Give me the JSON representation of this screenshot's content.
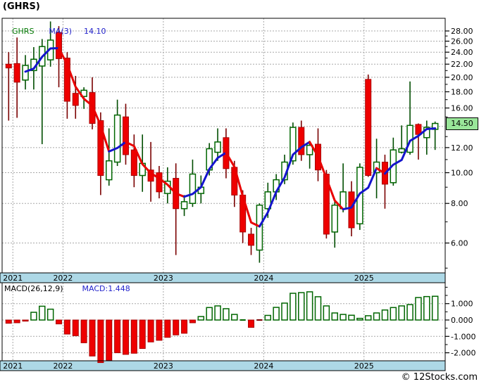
{
  "window": {
    "title": "(GHRS)"
  },
  "watermark": "© 12Stocks.com",
  "main_panel": {
    "legend": {
      "symbol": "GHRS",
      "ma_label": "MA(3)",
      "ma_value": "14.10"
    },
    "last_price_label": "14.50",
    "y_axis_labels": [
      "28.00",
      "26.00",
      "24.00",
      "22.00",
      "20.00",
      "18.00",
      "16.00",
      "12.00",
      "10.00",
      "8.00",
      "6.00"
    ]
  },
  "macd_panel": {
    "label": "MACD(26,12,9)",
    "value_label": "MACD:1.448",
    "y_axis_labels": [
      "1.000",
      "0.000",
      "-1.000",
      "-2.000"
    ]
  },
  "x_axis_years": [
    "2021",
    "2022",
    "2023",
    "2024",
    "2025"
  ],
  "colors": {
    "up_candle_border": "#006600",
    "up_candle_fill": "#FFFFFF",
    "down_candle_fill": "#EE0000",
    "down_candle_border": "#AA0000",
    "up_wick": "#004D00",
    "down_wick": "#7A0000",
    "ma_up": "#1414CC",
    "ma_down": "#E80000",
    "grid": "#A8A8A8",
    "axis_band_bg": "#ADD8E6",
    "price_badge_bg": "#99E699",
    "legend_symbol": "#007700",
    "legend_value": "#2222CC",
    "text": "#000000"
  },
  "chart_data": [
    {
      "type": "candlestick",
      "title": "GHRS monthly price with MA(3) overlay",
      "x_unit": "month",
      "months": [
        "2021-06",
        "2021-07",
        "2021-08",
        "2021-09",
        "2021-10",
        "2021-11",
        "2021-12",
        "2022-01",
        "2022-02",
        "2022-03",
        "2022-04",
        "2022-05",
        "2022-06",
        "2022-07",
        "2022-08",
        "2022-09",
        "2022-10",
        "2022-11",
        "2022-12",
        "2023-01",
        "2023-02",
        "2023-03",
        "2023-04",
        "2023-05",
        "2023-06",
        "2023-07",
        "2023-08",
        "2023-09",
        "2023-10",
        "2023-11",
        "2023-12",
        "2024-01",
        "2024-02",
        "2024-03",
        "2024-04",
        "2024-05",
        "2024-06",
        "2024-07",
        "2024-08",
        "2024-09",
        "2024-10",
        "2024-11",
        "2024-12",
        "2025-01",
        "2025-02",
        "2025-03",
        "2025-04",
        "2025-05",
        "2025-06",
        "2025-07",
        "2025-08",
        "2025-09"
      ],
      "ohlc": [
        [
          22.0,
          24.0,
          14.6,
          21.4
        ],
        [
          22.1,
          26.7,
          14.9,
          19.3
        ],
        [
          19.6,
          23.5,
          18.3,
          21.8
        ],
        [
          21.0,
          24.9,
          18.3,
          22.8
        ],
        [
          21.7,
          26.4,
          12.3,
          25.0
        ],
        [
          22.7,
          30.0,
          21.6,
          26.2
        ],
        [
          27.7,
          29.0,
          18.6,
          22.9
        ],
        [
          23.0,
          24.0,
          14.8,
          16.8
        ],
        [
          17.8,
          20.2,
          14.8,
          16.3
        ],
        [
          17.4,
          18.6,
          15.9,
          18.2
        ],
        [
          17.9,
          20.0,
          13.7,
          14.3
        ],
        [
          14.6,
          15.5,
          8.5,
          9.8
        ],
        [
          9.5,
          13.8,
          9.1,
          10.9
        ],
        [
          10.8,
          17.0,
          10.5,
          15.2
        ],
        [
          15.0,
          16.5,
          10.6,
          11.4
        ],
        [
          11.8,
          13.2,
          9.0,
          9.8
        ],
        [
          9.8,
          13.2,
          8.7,
          10.7
        ],
        [
          10.2,
          12.5,
          8.1,
          9.4
        ],
        [
          10.0,
          10.5,
          8.3,
          8.7
        ],
        [
          8.6,
          10.4,
          8.0,
          9.4
        ],
        [
          9.6,
          10.7,
          5.5,
          7.7
        ],
        [
          7.7,
          8.5,
          7.3,
          8.1
        ],
        [
          8.0,
          11.0,
          7.8,
          9.9
        ],
        [
          8.6,
          9.8,
          8.0,
          9.0
        ],
        [
          10.2,
          12.4,
          9.8,
          11.9
        ],
        [
          11.6,
          13.8,
          10.9,
          12.5
        ],
        [
          12.9,
          13.8,
          9.6,
          10.3
        ],
        [
          10.4,
          10.9,
          7.8,
          8.5
        ],
        [
          8.5,
          8.8,
          6.0,
          6.5
        ],
        [
          6.4,
          6.7,
          5.5,
          5.9
        ],
        [
          5.7,
          8.0,
          5.2,
          7.9
        ],
        [
          7.7,
          9.3,
          7.2,
          8.7
        ],
        [
          8.7,
          9.9,
          8.2,
          9.5
        ],
        [
          9.5,
          11.4,
          9.2,
          10.8
        ],
        [
          10.9,
          14.4,
          10.6,
          13.9
        ],
        [
          13.9,
          14.6,
          10.9,
          11.4
        ],
        [
          11.4,
          12.6,
          10.3,
          12.2
        ],
        [
          12.3,
          13.8,
          9.4,
          10.2
        ],
        [
          9.9,
          10.2,
          6.2,
          6.4
        ],
        [
          6.5,
          8.2,
          5.8,
          7.9
        ],
        [
          7.7,
          10.7,
          7.5,
          8.7
        ],
        [
          8.7,
          9.4,
          6.3,
          6.7
        ],
        [
          6.9,
          10.7,
          6.6,
          10.4
        ],
        [
          19.7,
          20.4,
          9.7,
          9.8
        ],
        [
          10.0,
          12.8,
          8.3,
          10.8
        ],
        [
          10.8,
          11.4,
          7.7,
          9.2
        ],
        [
          9.3,
          12.9,
          9.1,
          11.8
        ],
        [
          11.6,
          14.1,
          11.5,
          11.9
        ],
        [
          11.6,
          19.4,
          11.4,
          14.1
        ],
        [
          14.2,
          14.3,
          11.0,
          13.2
        ],
        [
          12.9,
          14.6,
          11.4,
          13.9
        ],
        [
          13.7,
          14.5,
          11.8,
          14.3
        ]
      ],
      "overlays": [
        {
          "name": "MA(3)",
          "period": 3,
          "current_value": 14.1
        }
      ],
      "last_price": 14.5,
      "scale": "log",
      "ylim": [
        4.83,
        30.7
      ],
      "y_ticks": [
        28,
        26,
        24,
        22,
        20,
        18,
        16,
        12,
        10,
        8,
        6
      ],
      "y_gridlines": [
        28,
        26,
        24,
        22,
        20,
        18,
        16,
        14,
        12,
        10,
        8,
        6
      ],
      "y_minor_ticks": [
        27,
        25,
        23,
        21,
        19,
        17,
        15,
        13,
        11,
        9,
        7,
        5
      ],
      "year_boundaries": [
        {
          "label": "2021",
          "index": 1
        },
        {
          "label": "2022",
          "index": 7
        },
        {
          "label": "2023",
          "index": 19
        },
        {
          "label": "2024",
          "index": 31
        },
        {
          "label": "2025",
          "index": 43
        }
      ],
      "grid": true,
      "legend_position": "top-left"
    },
    {
      "type": "bar",
      "title": "MACD(26,12,9) histogram",
      "x_unit": "month",
      "values": [
        -0.2,
        -0.17,
        -0.07,
        0.47,
        0.84,
        0.66,
        -0.24,
        -0.86,
        -0.96,
        -1.39,
        -2.2,
        -2.6,
        -2.46,
        -2.0,
        -2.1,
        -2.03,
        -1.74,
        -1.34,
        -1.24,
        -1.06,
        -0.91,
        -0.81,
        -0.17,
        0.21,
        0.76,
        0.86,
        0.69,
        0.34,
        0.02,
        -0.45,
        -0.05,
        0.28,
        0.77,
        1.03,
        1.63,
        1.67,
        1.72,
        1.42,
        0.86,
        0.43,
        0.34,
        0.29,
        0.1,
        0.26,
        0.43,
        0.61,
        0.76,
        0.86,
        0.94,
        1.37,
        1.43,
        1.448
      ],
      "last_value": 1.448,
      "ylim": [
        -2.49,
        2.275
      ],
      "y_ticks": [
        1,
        0,
        -1,
        -2
      ],
      "y_minor_ticks": [
        2,
        1.5,
        0.5,
        -0.5,
        -1.5
      ],
      "grid": true
    }
  ]
}
